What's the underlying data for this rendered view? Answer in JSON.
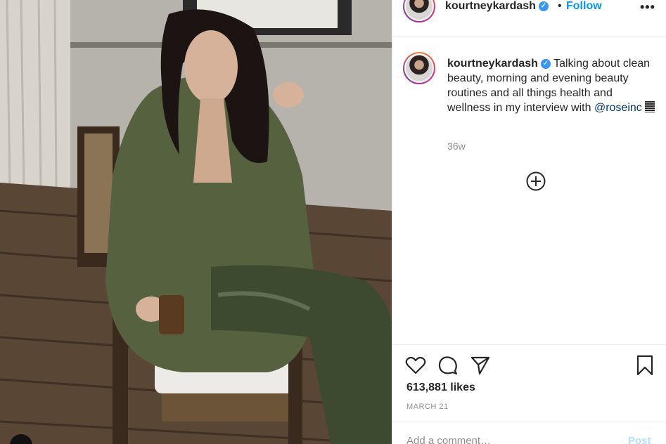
{
  "post": {
    "username": "kourtneykardash",
    "verified": true,
    "follow_label": "Follow",
    "separator": "•",
    "more_label": "•••",
    "caption_text": "Talking about clean beauty, morning and evening beauty routines and all things health and wellness in my interview with ",
    "caption_mention": "@roseinc",
    "time_ago": "36w",
    "likes": "613,881 likes",
    "date": "MARCH 21"
  },
  "comment": {
    "placeholder": "Add a comment…",
    "post_label": "Post"
  },
  "icons": {
    "heart": "heart-icon",
    "comment": "comment-icon",
    "share": "share-icon",
    "save": "bookmark-icon",
    "add": "plus-circle-icon",
    "verified": "verified-badge-icon"
  },
  "colors": {
    "accent": "#0095f6",
    "verified": "#3897f0",
    "muted": "#8e8e8e",
    "post_disabled": "#b2dffc"
  }
}
